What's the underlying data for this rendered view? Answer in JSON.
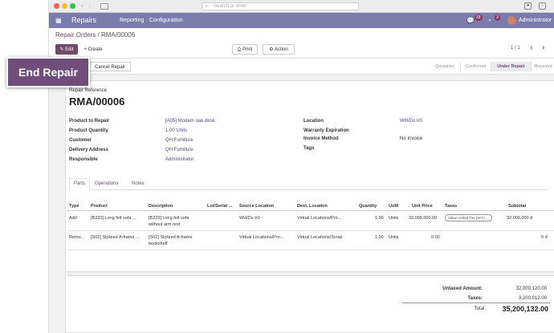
{
  "browser": {
    "url_placeholder": "Search or enter"
  },
  "nav": {
    "app_name": "Repairs",
    "menu": [
      "Reporting",
      "Configuration"
    ],
    "chat_count": "18",
    "activity_count": "3",
    "user": "Administrator"
  },
  "breadcrumb": {
    "parent": "Repair Orders",
    "separator": "/",
    "current": "RMA/00006"
  },
  "toolbar": {
    "edit": "Edit",
    "create": "Create",
    "print": "Print",
    "action": "Action",
    "pager": "1 / 1"
  },
  "status_buttons": {
    "cancel": "Cancel Repair"
  },
  "stages": [
    "Quotation",
    "Confirmed",
    "Under Repair",
    "Repaired"
  ],
  "active_stage": "Under Repair",
  "tooltip": "End Repair",
  "form": {
    "ref_label": "Repair Reference",
    "ref": "RMA/00006",
    "left": [
      {
        "label": "Product to Repair",
        "value": "[A05] Modern oak desk"
      },
      {
        "label": "Product Quantity",
        "value": "1.00 Units"
      },
      {
        "label": "Customer",
        "value": "QH Furniture"
      },
      {
        "label": "Delivery Address",
        "value": "QH Furniture"
      },
      {
        "label": "Responsible",
        "value": "Administrator"
      }
    ],
    "right": [
      {
        "label": "Location",
        "value": "WH/Du tr0"
      },
      {
        "label": "Warranty Expiration",
        "value": ""
      },
      {
        "label": "Invoice Method",
        "value": "No Invoice"
      },
      {
        "label": "Tags",
        "value": ""
      }
    ]
  },
  "tabs": [
    "Parts",
    "Operations",
    "Notes"
  ],
  "table": {
    "headers": [
      "Type",
      "Product",
      "Description",
      "Lot/Serial ...",
      "Source Location",
      "Dest. Location",
      "Quantity",
      "UoM",
      "Unit Price",
      "Taxes",
      "Subtotal"
    ],
    "rows": [
      {
        "type": "Add",
        "product": "[B220] Long felt sofa ...",
        "description": [
          "[B229] Long felt sofa",
          "without arm rest"
        ],
        "lot": "",
        "source": "WH/Du tr0",
        "dest": "Virtual Locations/Pro...",
        "qty": "1.00",
        "uom": "Units",
        "price": "32,000,000.00",
        "tax": "Value Added Tax (VAT) ...",
        "subtotal": "32,000,000 đ"
      },
      {
        "type": "Remo...",
        "product": "[S02] Stylized A-frame ...",
        "description": [
          "[S02] Stylized A-frame",
          "bookshelf"
        ],
        "lot": "",
        "source": "Virtual Locations/Pro...",
        "dest": "Virtual Locations/Scrap",
        "qty": "1.00",
        "uom": "Units",
        "price": "0.00",
        "tax": "",
        "subtotal": "0 đ"
      }
    ]
  },
  "totals": {
    "untaxed_label": "Untaxed Amount:",
    "untaxed": "32,000,120.00",
    "taxes_label": "Taxes:",
    "taxes": "3,200,012.00",
    "total_label": "Total:",
    "total": "35,200,132.00"
  },
  "colors": {
    "brand": "#7c7bad",
    "primary": "#714b67",
    "tooltip": "#6f4e7c"
  }
}
